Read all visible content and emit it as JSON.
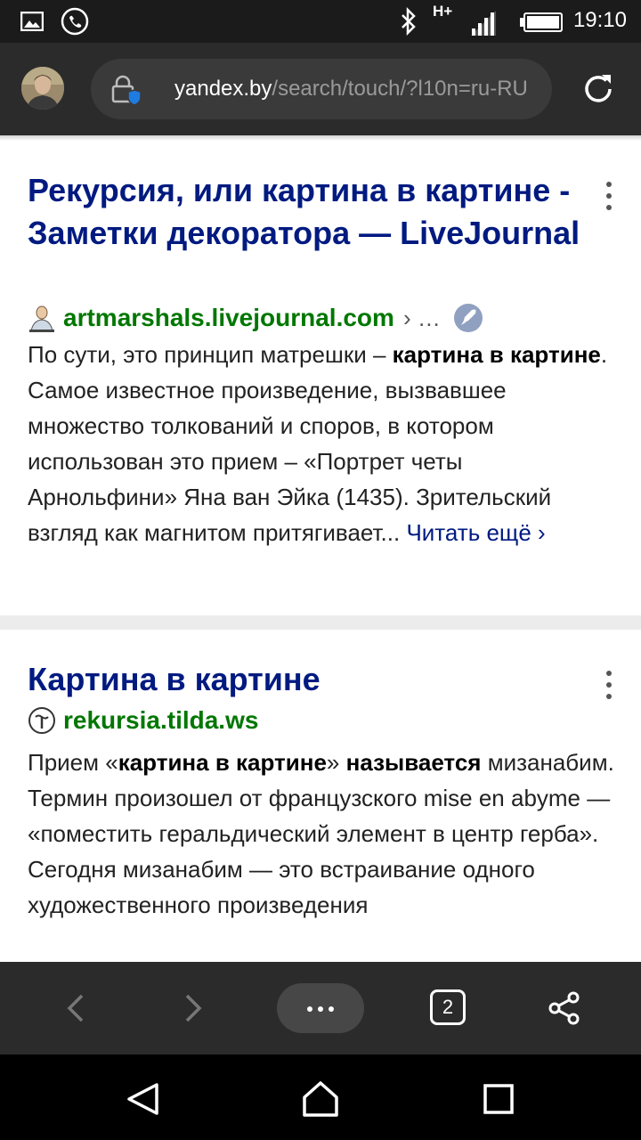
{
  "status_bar": {
    "time": "19:10",
    "network": "H+",
    "icons": [
      "gallery-icon",
      "phone-call-icon",
      "bluetooth-icon",
      "signal-icon",
      "battery-icon"
    ]
  },
  "browser": {
    "url_domain": "yandex.by",
    "url_path": "/search/touch/?l10n=ru-RU",
    "icons": [
      "avatar",
      "lock-shield-icon",
      "reload-icon"
    ]
  },
  "results": [
    {
      "title": "Рекурсия, или картина в картине - Заметки декоратора — LiveJournal",
      "domain": "artmarshals.livejournal.com",
      "more": "› …",
      "snippet_parts": [
        {
          "text": "По сути, это принцип матрешки – ",
          "bold": false
        },
        {
          "text": "картина в картине",
          "bold": true
        },
        {
          "text": ". Самое известное произведение, вызвавшее множество толкований и споров, в котором использован это прием – «Портрет четы Арнольфини» Яна ван Эйка (1435). Зрительский взгляд как магнитом притягивает... ",
          "bold": false
        }
      ],
      "read_more": "Читать ещё ›"
    },
    {
      "title": "Картина в картине",
      "domain": "rekursia.tilda.ws",
      "snippet_parts": [
        {
          "text": "Прием «",
          "bold": false
        },
        {
          "text": "картина в картине",
          "bold": true
        },
        {
          "text": "» ",
          "bold": false
        },
        {
          "text": "называется",
          "bold": true
        },
        {
          "text": " мизанабим. Термин произошел от французского mise en abyme — «поместить геральдический элемент в центр герба». Сегодня мизанабим — это встраивание одного художественного произведения",
          "bold": false
        }
      ]
    }
  ],
  "toolbar": {
    "tab_count": "2",
    "icons": [
      "back-icon",
      "forward-icon",
      "menu-dots-icon",
      "tabs-icon",
      "share-icon"
    ]
  },
  "navbar": {
    "icons": [
      "nav-back-icon",
      "nav-home-icon",
      "nav-recents-icon"
    ]
  },
  "colors": {
    "title": "#001a80",
    "domain": "#007700",
    "bar": "#2b2b2b"
  }
}
